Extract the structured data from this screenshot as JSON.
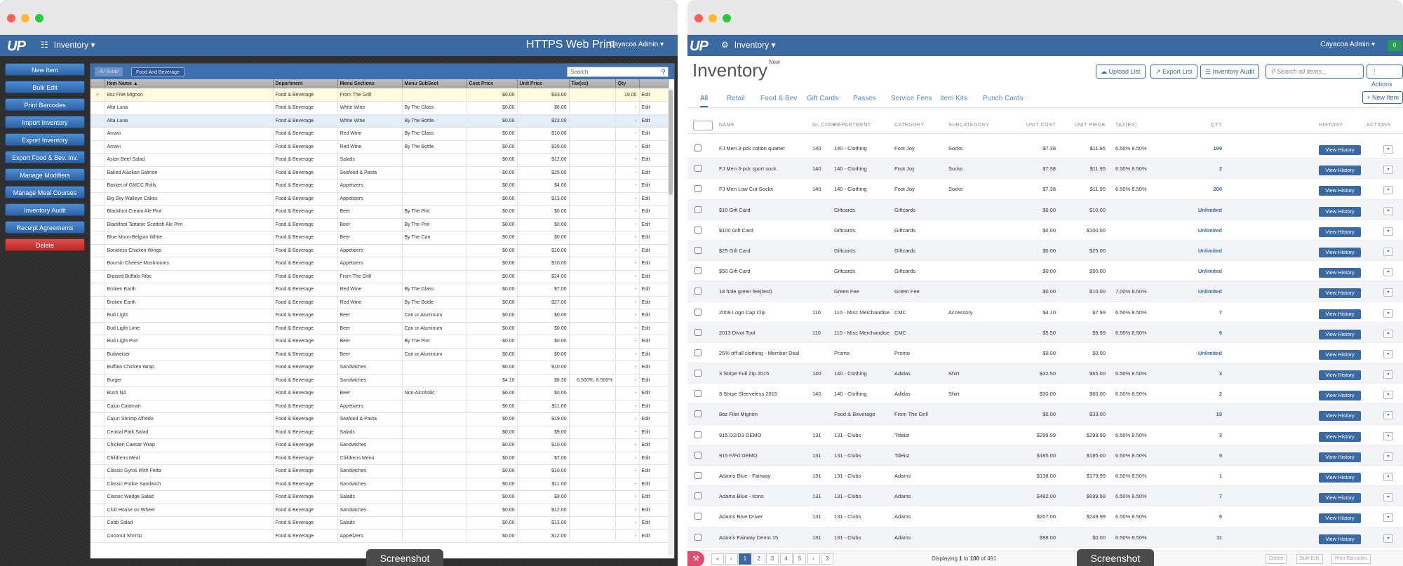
{
  "left_app": {
    "nav_logo": "UP",
    "nav_menu": "Inventory",
    "app_title": "HTTPS Web Print",
    "user": "Cayacoa Admin",
    "sidebar": [
      "New Item",
      "Bulk Edit",
      "Print Barcodes",
      "Import Inventory",
      "Export Inventory",
      "Export Food & Bev. Inv.",
      "Manage Modifiers",
      "Manage Meal Courses",
      "Inventory Audit",
      "Receipt Agreements",
      "Delete"
    ],
    "filter_tabs": [
      "All Retail",
      "Food And Beverage"
    ],
    "search_placeholder": "Search",
    "columns": [
      "",
      "Item Name ▲",
      "Department",
      "Menu Sections",
      "Menu SubSect",
      "Cost Price",
      "Unit Price",
      "Tax(es)",
      "Qty",
      ""
    ],
    "rows": [
      [
        "✔",
        "8oz Filet Mignon",
        "Food & Beverage",
        "From The Grill",
        "",
        "$0.00",
        "$33.00",
        "",
        "19.00",
        "Edit"
      ],
      [
        "",
        "Alta Luna",
        "Food & Beverage",
        "White Wine",
        "By The Glass",
        "$0.00",
        "$6.00",
        "",
        "-",
        "Edit"
      ],
      [
        "",
        "Alta Luna",
        "Food & Beverage",
        "White Wine",
        "By The Bottle",
        "$0.00",
        "$23.00",
        "",
        "-",
        "Edit"
      ],
      [
        "",
        "Amavi",
        "Food & Beverage",
        "Red Wine",
        "By The Glass",
        "$0.00",
        "$10.00",
        "",
        "-",
        "Edit"
      ],
      [
        "",
        "Amavi",
        "Food & Beverage",
        "Red Wine",
        "By The Bottle",
        "$0.00",
        "$39.00",
        "",
        "-",
        "Edit"
      ],
      [
        "",
        "Asian Beef Salad",
        "Food & Beverage",
        "Salads",
        "",
        "$0.00",
        "$12.00",
        "",
        "-",
        "Edit"
      ],
      [
        "",
        "Baked Alaskan Salmon",
        "Food & Beverage",
        "Seafood & Pasta",
        "",
        "$0.00",
        "$25.00",
        "",
        "-",
        "Edit"
      ],
      [
        "",
        "Basket of GMCC Rolls",
        "Food & Beverage",
        "Appetizers",
        "",
        "$0.00",
        "$4.00",
        "",
        "-",
        "Edit"
      ],
      [
        "",
        "Big Sky Walleye Cakes",
        "Food & Beverage",
        "Appetizers",
        "",
        "$0.00",
        "$13.00",
        "",
        "-",
        "Edit"
      ],
      [
        "",
        "Blackfoot Cream Ale Pint",
        "Food & Beverage",
        "Beer",
        "By The Pint",
        "$0.00",
        "$0.00",
        "",
        "-",
        "Edit"
      ],
      [
        "",
        "Blackfoot Tartanic Scottish Ale Pint",
        "Food & Beverage",
        "Beer",
        "By The Pint",
        "$0.00",
        "$0.00",
        "",
        "-",
        "Edit"
      ],
      [
        "",
        "Blue Moon Belgian White",
        "Food & Beverage",
        "Beer",
        "By The Can",
        "$0.00",
        "$0.00",
        "",
        "-",
        "Edit"
      ],
      [
        "",
        "Boneless Chicken Wings",
        "Food & Beverage",
        "Appetizers",
        "",
        "$0.00",
        "$10.00",
        "",
        "-",
        "Edit"
      ],
      [
        "",
        "Boursin Cheese Mushrooms",
        "Food & Beverage",
        "Appetizers",
        "",
        "$0.00",
        "$10.00",
        "",
        "-",
        "Edit"
      ],
      [
        "",
        "Braised Buffalo Ribs",
        "Food & Beverage",
        "From The Grill",
        "",
        "$0.00",
        "$24.00",
        "",
        "-",
        "Edit"
      ],
      [
        "",
        "Broken Earth",
        "Food & Beverage",
        "Red Wine",
        "By The Glass",
        "$0.00",
        "$7.00",
        "",
        "-",
        "Edit"
      ],
      [
        "",
        "Broken Earth",
        "Food & Beverage",
        "Red Wine",
        "By The Bottle",
        "$0.00",
        "$27.00",
        "",
        "-",
        "Edit"
      ],
      [
        "",
        "Bud Light",
        "Food & Beverage",
        "Beer",
        "Can or Aluminum",
        "$0.00",
        "$0.00",
        "",
        "-",
        "Edit"
      ],
      [
        "",
        "Bud Light Lime",
        "Food & Beverage",
        "Beer",
        "Can or Aluminum",
        "$0.00",
        "$0.00",
        "",
        "-",
        "Edit"
      ],
      [
        "",
        "Bud Light Pint",
        "Food & Beverage",
        "Beer",
        "By The Pint",
        "$0.00",
        "$0.00",
        "",
        "-",
        "Edit"
      ],
      [
        "",
        "Budweiser",
        "Food & Beverage",
        "Beer",
        "Can or Aluminum",
        "$0.00",
        "$0.00",
        "",
        "-",
        "Edit"
      ],
      [
        "",
        "Buffalo Chicken Wrap",
        "Food & Beverage",
        "Sandwiches",
        "",
        "$0.00",
        "$10.00",
        "",
        "-",
        "Edit"
      ],
      [
        "",
        "Burger",
        "Food & Beverage",
        "Sandwiches",
        "",
        "$4.10",
        "$8.30",
        "6.500%, 8.500%",
        "-",
        "Edit"
      ],
      [
        "",
        "Bush NA",
        "Food & Beverage",
        "Beer",
        "Non-Alcoholic",
        "$0.00",
        "$0.00",
        "",
        "-",
        "Edit"
      ],
      [
        "",
        "Cajun Calamari",
        "Food & Beverage",
        "Appetizers",
        "",
        "$0.00",
        "$11.00",
        "",
        "-",
        "Edit"
      ],
      [
        "",
        "Cajun Shrimp Alfredo",
        "Food & Beverage",
        "Seafood & Pasta",
        "",
        "$0.00",
        "$19.00",
        "",
        "-",
        "Edit"
      ],
      [
        "",
        "Central Park Salad",
        "Food & Beverage",
        "Salads",
        "",
        "$0.00",
        "$9.00",
        "",
        "-",
        "Edit"
      ],
      [
        "",
        "Chicken Caesar Wrap",
        "Food & Beverage",
        "Sandwiches",
        "",
        "$0.00",
        "$10.00",
        "",
        "-",
        "Edit"
      ],
      [
        "",
        "Childrens Meal",
        "Food & Beverage",
        "Childrens Menu",
        "",
        "$0.00",
        "$7.00",
        "",
        "-",
        "Edit"
      ],
      [
        "",
        "Classic Gyros With Fetta",
        "Food & Beverage",
        "Sandwiches",
        "",
        "$0.00",
        "$10.00",
        "",
        "-",
        "Edit"
      ],
      [
        "",
        "Classic Porkie Sandwich",
        "Food & Beverage",
        "Sandwiches",
        "",
        "$0.00",
        "$11.00",
        "",
        "-",
        "Edit"
      ],
      [
        "",
        "Classic Wedge Salad",
        "Food & Beverage",
        "Salads",
        "",
        "$0.00",
        "$9.00",
        "",
        "-",
        "Edit"
      ],
      [
        "",
        "Club House on Wheel",
        "Food & Beverage",
        "Sandwiches",
        "",
        "$0.00",
        "$12.00",
        "",
        "-",
        "Edit"
      ],
      [
        "",
        "Cobb Salad",
        "Food & Beverage",
        "Salads",
        "",
        "$0.00",
        "$13.00",
        "",
        "-",
        "Edit"
      ],
      [
        "",
        "Coconut Shrimp",
        "Food & Beverage",
        "Appetizers",
        "",
        "$0.00",
        "$12.00",
        "",
        "-",
        "Edit"
      ]
    ]
  },
  "right_app": {
    "nav_logo": "UP",
    "nav_menu": "Inventory",
    "user": "Cayacoa Admin",
    "battery": "0",
    "title": "Inventory",
    "title_badge": "New",
    "buttons": {
      "upload": "Upload List",
      "export": "Export List",
      "audit": "Inventory Audit",
      "search_placeholder": "Search all items...",
      "actions": "Actions",
      "new_item": "+ New Item"
    },
    "tabs": [
      "All",
      "Retail",
      "Food & Bev",
      "Gift Cards",
      "Passes",
      "Service Fees",
      "Item Kits",
      "Punch Cards"
    ],
    "columns": [
      "NAME",
      "GL CODE",
      "DEPARTMENT",
      "CATEGORY",
      "SUBCATEGORY",
      "UNIT COST",
      "UNIT PRICE",
      "TAX(ES)",
      "QTY",
      "HISTORY",
      "ACTIONS"
    ],
    "view_history": "View History",
    "rows": [
      [
        "FJ Men 3-pck cotton quarter",
        "140",
        "140 - Clothing",
        "Foot Joy",
        "Socks",
        "$7.38",
        "$11.95",
        "6.50% 8.50%",
        "199"
      ],
      [
        "FJ Men 3-pck sport sock",
        "140",
        "140 - Clothing",
        "Foot Joy",
        "Socks",
        "$7.38",
        "$11.95",
        "6.50% 8.50%",
        "2"
      ],
      [
        "FJ Men Low Cut Socks",
        "140",
        "140 - Clothing",
        "Foot Joy",
        "Socks",
        "$7.38",
        "$11.95",
        "6.50% 8.50%",
        "200"
      ],
      [
        "$10 Gift Card",
        "",
        "Giftcards",
        "Giftcards",
        "",
        "$0.00",
        "$10.00",
        "",
        "Unlimited"
      ],
      [
        "$100 Gift Card",
        "",
        "Giftcards",
        "Giftcards",
        "",
        "$0.00",
        "$100.00",
        "",
        "Unlimited"
      ],
      [
        "$25 Gift Card",
        "",
        "Giftcards",
        "Giftcards",
        "",
        "$0.00",
        "$25.00",
        "",
        "Unlimited"
      ],
      [
        "$50 Gift Card",
        "",
        "Giftcards",
        "Giftcards",
        "",
        "$0.00",
        "$50.00",
        "",
        "Unlimited"
      ],
      [
        "18 hole green fee(test)",
        "",
        "Green Fee",
        "Green Fee",
        "",
        "$0.00",
        "$10.00",
        "7.00% 8.50%",
        "Unlimited"
      ],
      [
        "2009 Logo Cap Clip",
        "110",
        "110 - Misc Merchandise",
        "CMC",
        "Accessory",
        "$4.10",
        "$7.99",
        "6.50% 8.50%",
        "7"
      ],
      [
        "2013 Divot Tool",
        "110",
        "110 - Misc Merchandise",
        "CMC",
        "",
        "$5.50",
        "$9.99",
        "6.50% 8.50%",
        "6"
      ],
      [
        "25% off all clothing - Member Deal",
        "",
        "Promo",
        "Promo",
        "",
        "$0.00",
        "$0.00",
        "",
        "Unlimited"
      ],
      [
        "3 Stripe Full Zip 2015",
        "140",
        "140 - Clothing",
        "Adidas",
        "Shirt",
        "$32.50",
        "$65.00",
        "6.50% 8.50%",
        "3"
      ],
      [
        "3 Stripe Sleeveless 2015",
        "140",
        "140 - Clothing",
        "Adidas",
        "Shirt",
        "$30.00",
        "$60.00",
        "6.50% 8.50%",
        "2"
      ],
      [
        "8oz Filet Mignon",
        "",
        "Food & Beverage",
        "From The Grill",
        "",
        "$0.00",
        "$33.00",
        "",
        "19"
      ],
      [
        "915 D2/D3 DEMO",
        "131",
        "131 - Clubs",
        "Titleist",
        "",
        "$299.99",
        "$299.99",
        "6.50% 8.50%",
        "3"
      ],
      [
        "915 F/Fd DEMO",
        "131",
        "131 - Clubs",
        "Titleist",
        "",
        "$185.00",
        "$185.00",
        "6.50% 8.50%",
        "5"
      ],
      [
        "Adams Blue - Fairway",
        "131",
        "131 - Clubs",
        "Adams",
        "",
        "$138.00",
        "$179.99",
        "6.50% 8.50%",
        "1"
      ],
      [
        "Adams Blue - Irons",
        "131",
        "131 - Clubs",
        "Adams",
        "",
        "$482.00",
        "$699.99",
        "6.50% 8.50%",
        "7"
      ],
      [
        "Adams Blue Driver",
        "131",
        "131 - Clubs",
        "Adams",
        "",
        "$207.00",
        "$249.99",
        "6.50% 8.50%",
        "5"
      ],
      [
        "Adams Fairway Demo 15",
        "131",
        "131 - Clubs",
        "Adams",
        "",
        "$98.00",
        "$0.00",
        "6.50% 8.50%",
        "11"
      ]
    ],
    "pagination": [
      "«",
      "‹",
      "1",
      "2",
      "3",
      "4",
      "5",
      "›",
      "3"
    ],
    "display_prefix": "Displaying ",
    "display_from": "1",
    "display_mid": " to ",
    "display_to": "100",
    "display_suffix": " of 491",
    "footer_buttons": [
      "Delete",
      "Bulk Edit",
      "Print Barcodes"
    ]
  },
  "screenshot_label": "Screenshot"
}
